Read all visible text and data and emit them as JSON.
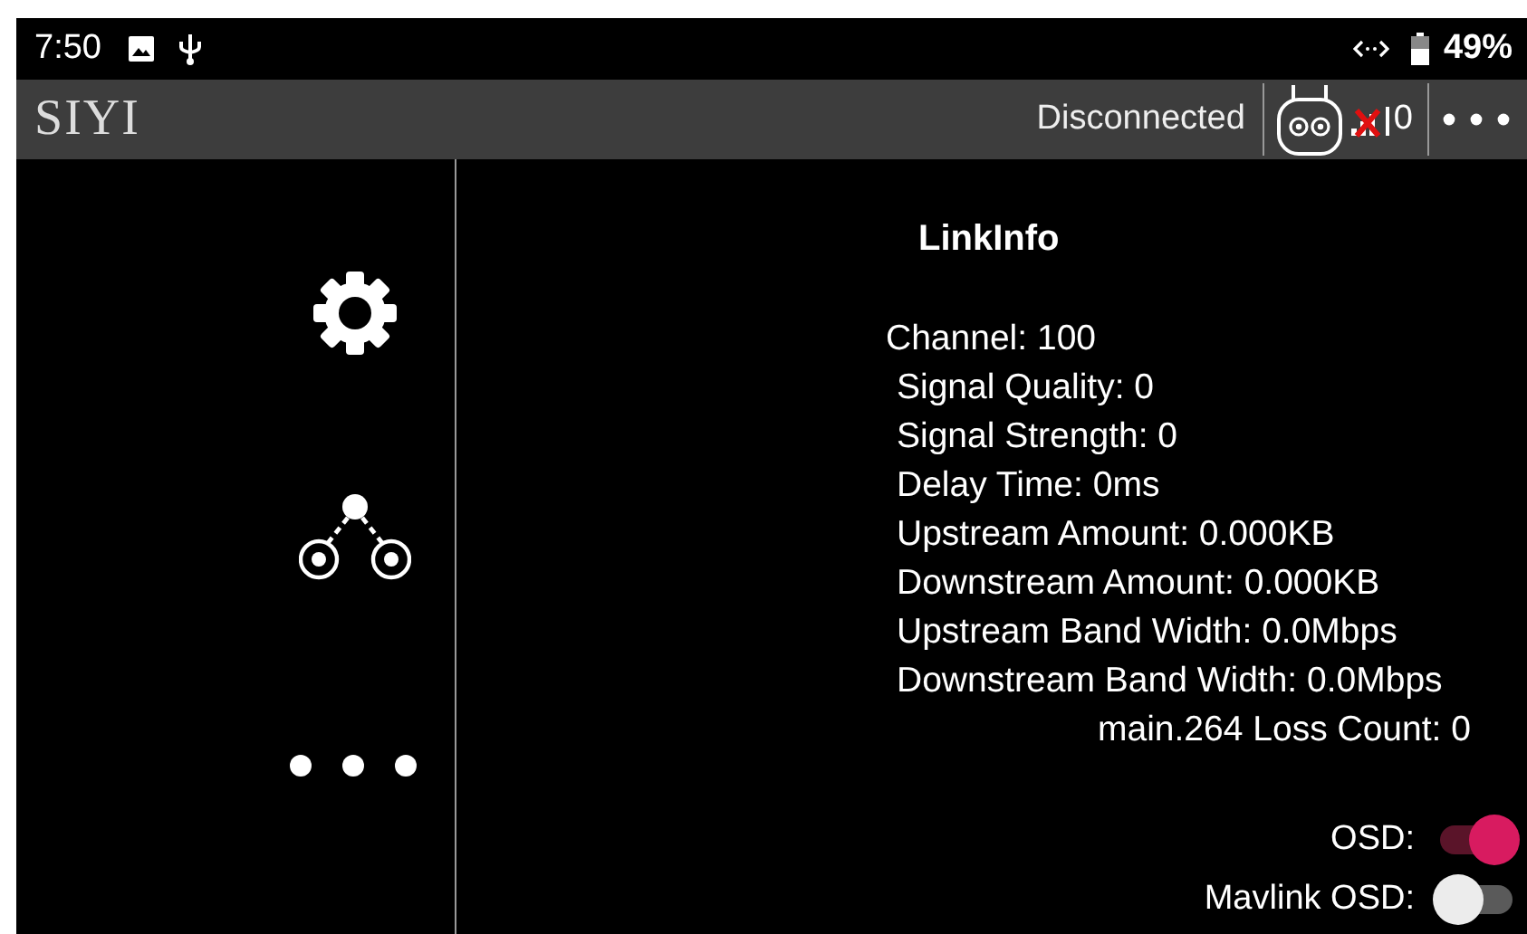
{
  "status_bar": {
    "time": "7:50",
    "battery": "49%"
  },
  "app_bar": {
    "logo": "SIYI",
    "connection": "Disconnected",
    "signal_count": "0"
  },
  "link_info": {
    "title": "LinkInfo",
    "lines": [
      "Channel: 100",
      "Signal Quality: 0",
      "Signal Strength: 0",
      "Delay Time: 0ms",
      "Upstream Amount: 0.000KB",
      "Downstream Amount: 0.000KB",
      "Upstream Band Width: 0.0Mbps",
      "Downstream Band Width: 0.0Mbps"
    ],
    "loss_count": "main.264 Loss Count: 0"
  },
  "toggles": [
    {
      "label": "OSD:",
      "on": true
    },
    {
      "label": "Mavlink OSD:",
      "on": false
    }
  ]
}
